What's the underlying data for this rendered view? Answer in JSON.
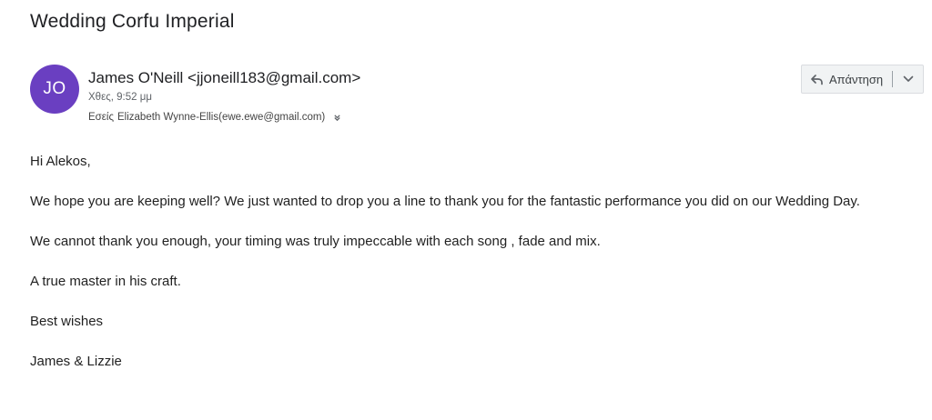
{
  "email": {
    "subject": "Wedding Corfu Imperial",
    "sender": {
      "initials": "JO",
      "avatar_color": "#6a3fc1",
      "name": "James O'Neill",
      "email": "jjoneill183@gmail.com"
    },
    "date": "Χθες, 9:52 μμ",
    "to": {
      "label": "Εσείς",
      "name": "Elizabeth Wynne-Ellis",
      "email": "ewe.ewe@gmail.com",
      "expand_icon": "double-chevron-down-icon"
    },
    "actions": {
      "reply_label": "Απάντηση",
      "reply_icon": "reply-arrow-icon",
      "more_icon": "chevron-down-icon"
    },
    "body": [
      "Hi Alekos,",
      "We hope you are keeping well? We just wanted to drop you a line to thank you for the fantastic performance you did on our Wedding Day.",
      "We cannot thank you enough, your timing was truly impeccable with each song , fade and mix.",
      "A true master in his craft.",
      "Best wishes",
      "James & Lizzie"
    ]
  }
}
